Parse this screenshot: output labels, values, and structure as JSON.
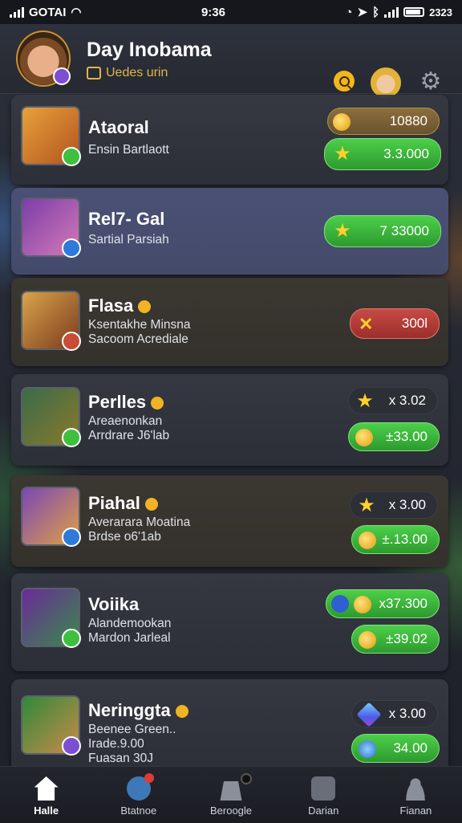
{
  "status_bar": {
    "carrier": "GOTAI",
    "time": "9:36",
    "battery": "2323"
  },
  "header": {
    "title": "Day Inobama",
    "subtitle": "Uedes urin"
  },
  "players": [
    {
      "name": "Ataoral",
      "lines": [
        "Ensin Bartlaott"
      ],
      "pills": [
        {
          "style": "gold",
          "icon": "coin",
          "value": "10880"
        },
        {
          "style": "green",
          "icon": "star",
          "value": "3.3.000"
        }
      ],
      "crown": false,
      "highlight": false
    },
    {
      "name": "Rel7- Gal",
      "lines": [
        "Sartial Parsiah"
      ],
      "pills": [
        {
          "style": "green",
          "icon": "star",
          "value": "7 33000"
        }
      ],
      "crown": false,
      "highlight": true
    },
    {
      "name": "Flasa",
      "lines": [
        "Ksentakhe Minsna",
        "Sacoom Acrediale"
      ],
      "pills": [
        {
          "style": "red",
          "icon": "x",
          "value": "300l"
        }
      ],
      "crown": true,
      "highlight": false
    },
    {
      "name": "Perlles",
      "lines": [
        "Areaenonkan",
        "Arrdrare J6'lab"
      ],
      "pills": [
        {
          "style": "dark",
          "icon": "star",
          "value": "x 3.02"
        },
        {
          "style": "green",
          "icon": "coin",
          "value": "±33.00"
        }
      ],
      "crown": true,
      "highlight": false
    },
    {
      "name": "Piahal",
      "lines": [
        "Averarara Moatina",
        "Brdse o6'1ab"
      ],
      "pills": [
        {
          "style": "dark",
          "icon": "star",
          "value": "x 3.00"
        },
        {
          "style": "green",
          "icon": "coin",
          "value": "±.13.00"
        }
      ],
      "crown": true,
      "highlight": false
    },
    {
      "name": "Voiika",
      "lines": [
        "Alandemookan",
        "Mardon Jarleal"
      ],
      "pills": [
        {
          "style": "green",
          "icon": "coin",
          "value": "x37.300"
        },
        {
          "style": "green",
          "icon": "coin",
          "value": "±39.02"
        }
      ],
      "crown": false,
      "highlight": false
    },
    {
      "name": "Neringgta",
      "lines": [
        "Beenee Green..",
        "Irade.9.00",
        "Fuasan 30J"
      ],
      "pills": [
        {
          "style": "dark",
          "icon": "gem",
          "value": "x 3.00"
        },
        {
          "style": "green",
          "icon": "coin",
          "value": "34.00"
        }
      ],
      "crown": true,
      "highlight": false
    }
  ],
  "nav": [
    {
      "label": "Halle",
      "icon": "home-icon",
      "active": true
    },
    {
      "label": "Btatnoe",
      "icon": "battle-icon",
      "active": false
    },
    {
      "label": "Beroogle",
      "icon": "bag-icon",
      "active": false
    },
    {
      "label": "Darian",
      "icon": "camera-icon",
      "active": false
    },
    {
      "label": "Fianan",
      "icon": "person-icon",
      "active": false
    }
  ],
  "colors": {
    "accent_gold": "#e0b648",
    "green": "#3fbf3e",
    "red": "#c74a45",
    "highlight": "#4b5175"
  }
}
